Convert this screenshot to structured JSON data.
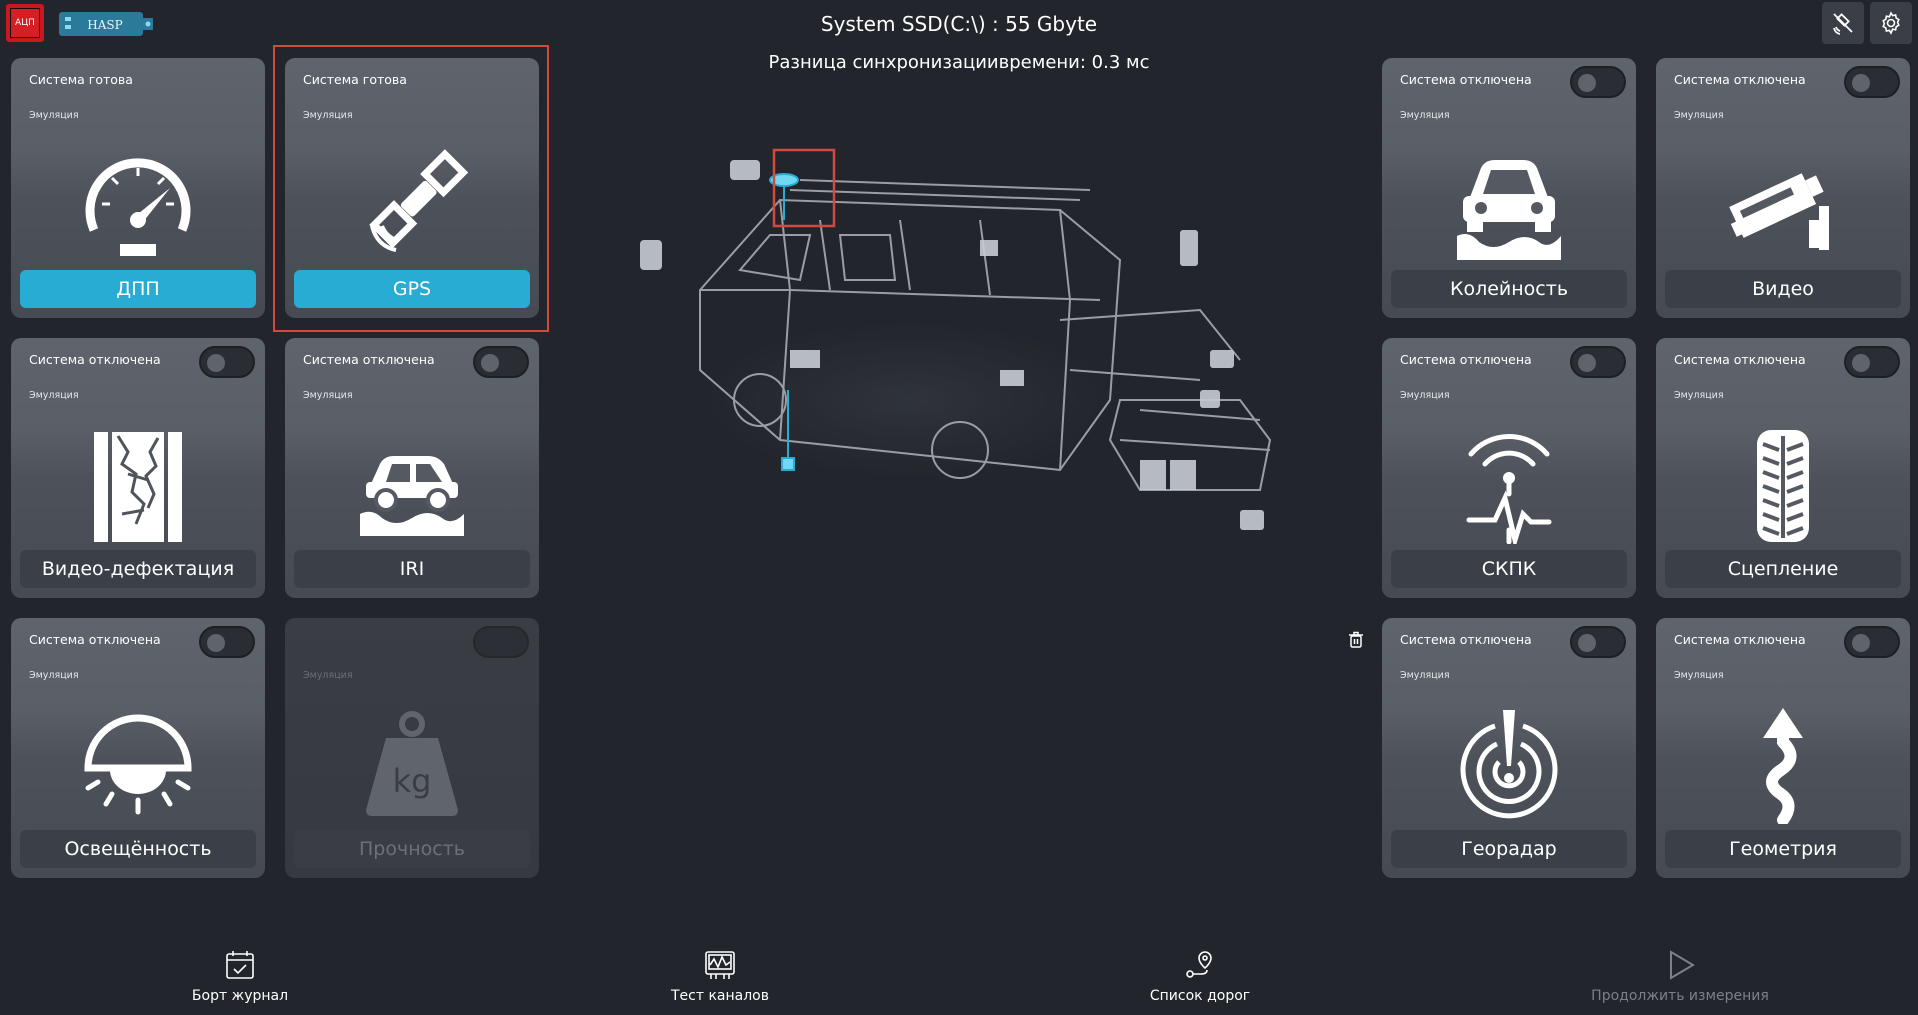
{
  "header": {
    "chip_label": "АЦП",
    "hasp_label": "HASP",
    "disk_info": "System SSD(C:\\) : 55 Gbyte",
    "sync_info": "Разница синхронизациивремени: 0.3 мс"
  },
  "cards": [
    {
      "status": "Система готова",
      "emulation": "Эмуляция",
      "label": "ДПП",
      "state": "ready"
    },
    {
      "status": "Система готова",
      "emulation": "Эмуляция",
      "label": "GPS",
      "state": "ready"
    },
    {
      "status": "Система отключена",
      "emulation": "Эмуляция",
      "label": "Видео-дефектация",
      "state": "off"
    },
    {
      "status": "Система отключена",
      "emulation": "Эмуляция",
      "label": "IRI",
      "state": "off"
    },
    {
      "status": "Система отключена",
      "emulation": "Эмуляция",
      "label": "Освещённость",
      "state": "off"
    },
    {
      "status": "",
      "emulation": "Эмуляция",
      "label": "Прочность",
      "state": "disabled"
    },
    {
      "status": "Система отключена",
      "emulation": "Эмуляция",
      "label": "Колейность",
      "state": "off"
    },
    {
      "status": "Система отключена",
      "emulation": "Эмуляция",
      "label": "Видео",
      "state": "off"
    },
    {
      "status": "Система отключена",
      "emulation": "Эмуляция",
      "label": "СКПК",
      "state": "off"
    },
    {
      "status": "Система отключена",
      "emulation": "Эмуляция",
      "label": "Сцепление",
      "state": "off"
    },
    {
      "status": "Система отключена",
      "emulation": "Эмуляция",
      "label": "Георадар",
      "state": "off"
    },
    {
      "status": "Система отключена",
      "emulation": "Эмуляция",
      "label": "Геометрия",
      "state": "off"
    }
  ],
  "footer": {
    "log_label": "Борт журнал",
    "test_label": "Тест каналов",
    "roads_label": "Список дорог",
    "continue_label": "Продолжить измерения"
  },
  "colors": {
    "accent": "#29acd4",
    "highlight": "#d24a3f",
    "background": "#22252b"
  }
}
